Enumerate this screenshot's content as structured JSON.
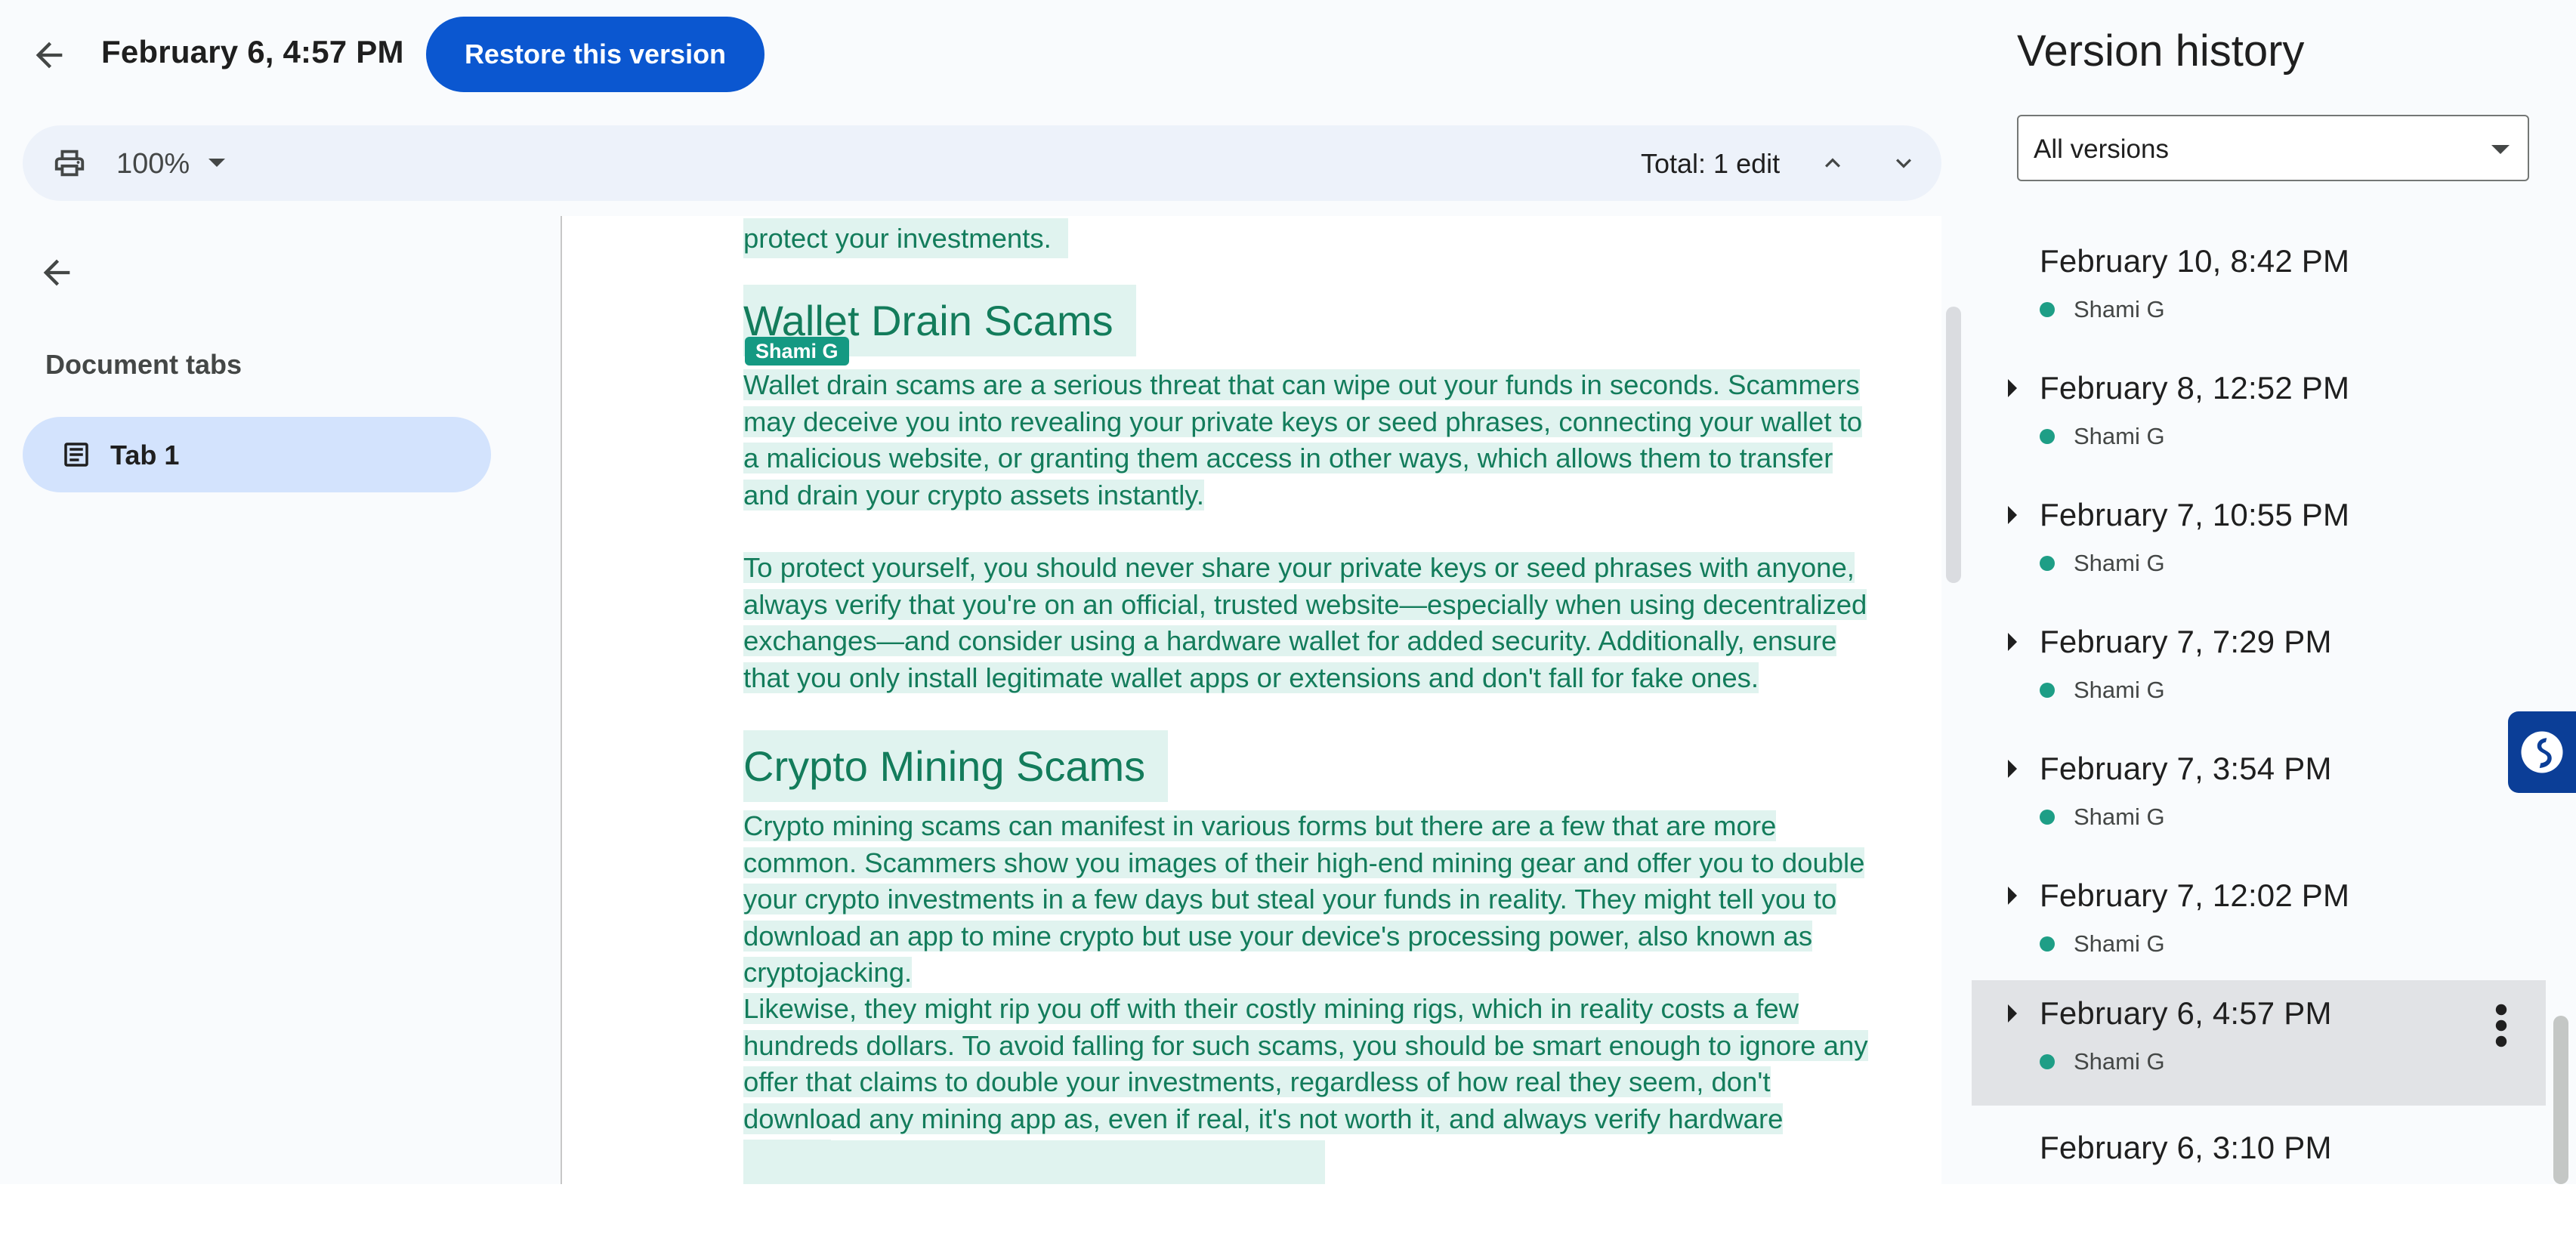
{
  "header": {
    "version_title": "February 6, 4:57 PM",
    "restore_label": "Restore this version"
  },
  "toolbar": {
    "zoom": "100%",
    "total_edits": "Total: 1 edit"
  },
  "tabs_panel": {
    "heading": "Document tabs",
    "tabs": [
      {
        "label": "Tab 1"
      }
    ]
  },
  "document": {
    "intro_tail": "protect your investments.",
    "author_chip": "Shami G",
    "section1": {
      "heading": "Wallet Drain Scams",
      "p1": "Wallet drain scams are a serious threat that can wipe out your funds in seconds. Scammers may deceive you into revealing your private keys or seed phrases, connecting your wallet to a malicious website, or granting them access in other ways, which allows them to transfer and drain your crypto assets instantly.",
      "p2": "To protect yourself, you should never share your private keys or seed phrases with anyone, always verify that you're on an official, trusted website—especially when using decentralized exchanges—and consider using a hardware wallet for added security. Additionally, ensure that you only install legitimate wallet apps or extensions and don't fall for fake ones."
    },
    "section2": {
      "heading": "Crypto Mining Scams",
      "p1": "Crypto mining scams can manifest in various forms but there are a few that are more common. Scammers show you images of their high-end mining gear and offer you to double your crypto investments in a few days but steal your funds in reality. They might tell you to download an app to mine crypto but use your device's processing power, also known as cryptojacking.",
      "p2": "Likewise, they might rip you off with their costly mining rigs, which in reality costs a few hundreds dollars. To avoid falling for such scams, you should be smart enough to ignore any offer that claims to double your investments, regardless of how real they seem, don't download any mining app as, even if real, it's not worth it, and always verify hardware sellers."
    }
  },
  "history": {
    "title": "Version history",
    "filter": "All versions",
    "versions": [
      {
        "date": "February 10, 8:42 PM",
        "author": "Shami G"
      },
      {
        "date": "February 8, 12:52 PM",
        "author": "Shami G"
      },
      {
        "date": "February 7, 10:55 PM",
        "author": "Shami G"
      },
      {
        "date": "February 7, 7:29 PM",
        "author": "Shami G"
      },
      {
        "date": "February 7, 3:54 PM",
        "author": "Shami G"
      },
      {
        "date": "February 7, 12:02 PM",
        "author": "Shami G"
      },
      {
        "date": "February 6, 4:57 PM",
        "author": "Shami G"
      },
      {
        "date": "February 6, 3:10 PM",
        "author": ""
      }
    ]
  },
  "colors": {
    "accent": "#0b57d0",
    "edit_text": "#137c5b",
    "edit_highlight": "#e0f3ef",
    "author_dot": "#1e9e86",
    "selected_row": "#e1e3e6"
  }
}
